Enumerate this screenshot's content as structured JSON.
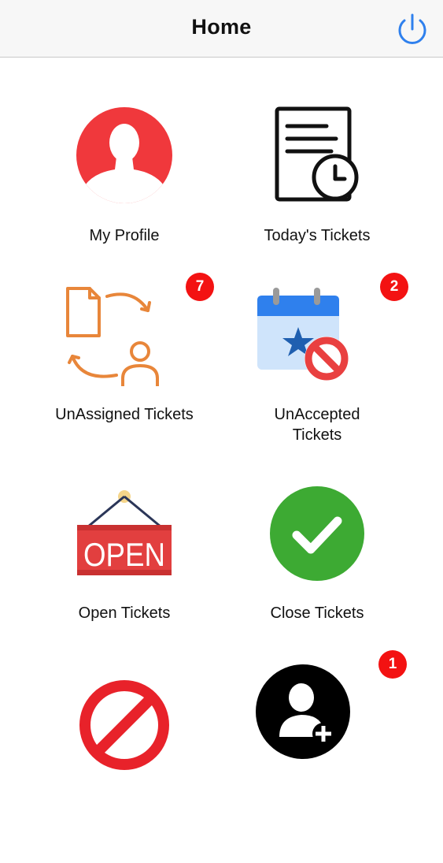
{
  "header": {
    "title": "Home",
    "power_icon": "power-icon",
    "accent_color": "#2f80ed"
  },
  "tiles": [
    {
      "label": "My Profile",
      "icon": "profile-icon",
      "badge": null
    },
    {
      "label": "Today's Tickets",
      "icon": "document-clock-icon",
      "badge": null
    },
    {
      "label": "UnAssigned Tickets",
      "icon": "unassigned-icon",
      "badge": "7"
    },
    {
      "label": "UnAccepted Tickets",
      "icon": "calendar-blocked-icon",
      "badge": "2"
    },
    {
      "label": "Open Tickets",
      "icon": "open-sign-icon",
      "badge": null
    },
    {
      "label": "Close Tickets",
      "icon": "checkmark-icon",
      "badge": null
    },
    {
      "label": "",
      "icon": "no-entry-icon",
      "badge": null
    },
    {
      "label": "",
      "icon": "add-user-icon",
      "badge": "1"
    }
  ],
  "colors": {
    "badge": "#f31212",
    "profile": "#f0383c",
    "check": "#3daa33",
    "open_sign": "#e23f3f",
    "unassigned": "#e8863a"
  }
}
